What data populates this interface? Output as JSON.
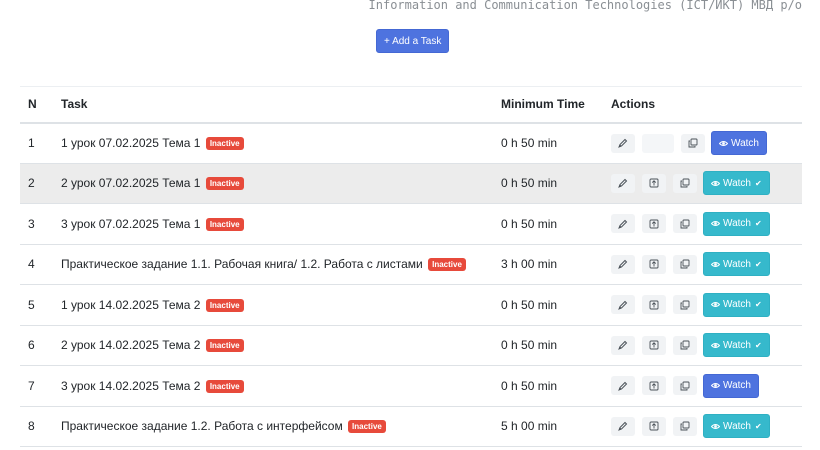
{
  "header": {
    "caption": "Information and Communication Technologies (ICT/ИКТ) МВД р/о",
    "add_task_label": "+ Add a Task"
  },
  "table": {
    "columns": {
      "n": "N",
      "task": "Task",
      "minimum_time": "Minimum Time",
      "actions": "Actions"
    },
    "rows": [
      {
        "n": "1",
        "task": "1 урок 07.02.2025 Тема 1",
        "badge": "Inactive",
        "time": "0 h 50 min",
        "watch": "Watch",
        "watch_style": "blue",
        "has_move": false,
        "watched": false
      },
      {
        "n": "2",
        "task": "2 урок 07.02.2025 Тема 1",
        "badge": "Inactive",
        "time": "0 h 50 min",
        "watch": "Watch",
        "watch_style": "teal",
        "has_move": true,
        "watched": true
      },
      {
        "n": "3",
        "task": "3 урок 07.02.2025 Тема 1",
        "badge": "Inactive",
        "time": "0 h 50 min",
        "watch": "Watch",
        "watch_style": "teal",
        "has_move": true,
        "watched": true
      },
      {
        "n": "4",
        "task": "Практическое задание 1.1. Рабочая книга/ 1.2. Работа с листами",
        "badge": "Inactive",
        "time": "3 h 00 min",
        "watch": "Watch",
        "watch_style": "teal",
        "has_move": true,
        "watched": true
      },
      {
        "n": "5",
        "task": "1 урок 14.02.2025 Тема 2",
        "badge": "Inactive",
        "time": "0 h 50 min",
        "watch": "Watch",
        "watch_style": "teal",
        "has_move": true,
        "watched": true
      },
      {
        "n": "6",
        "task": "2 урок 14.02.2025 Тема 2",
        "badge": "Inactive",
        "time": "0 h 50 min",
        "watch": "Watch",
        "watch_style": "teal",
        "has_move": true,
        "watched": true
      },
      {
        "n": "7",
        "task": "3 урок 14.02.2025 Тема 2",
        "badge": "Inactive",
        "time": "0 h 50 min",
        "watch": "Watch",
        "watch_style": "blue",
        "has_move": true,
        "watched": false
      },
      {
        "n": "8",
        "task": "Практическое задание 1.2. Работа с интерфейсом",
        "badge": "Inactive",
        "time": "5 h 00 min",
        "watch": "Watch",
        "watch_style": "teal",
        "has_move": true,
        "watched": true
      }
    ]
  },
  "colors": {
    "primary": "#4e73df",
    "info": "#36b9cc",
    "danger": "#e74a3b",
    "row_hover": "#ececec"
  },
  "icons": {
    "edit": "edit-icon",
    "move": "move-up-icon",
    "copy": "copy-icon",
    "watch": "eye-icon",
    "watched": "check-icon"
  }
}
